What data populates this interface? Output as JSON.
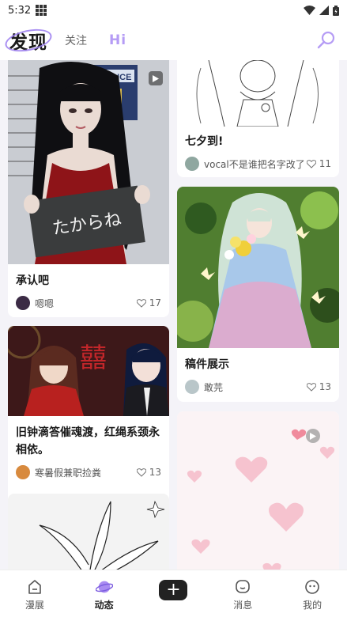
{
  "status_bar": {
    "time": "5:32"
  },
  "header": {
    "title": "发现",
    "tab_follow": "关注",
    "tab_hi": "Hi"
  },
  "posts": [
    {
      "title": "",
      "author": "",
      "likes": "",
      "thumb": "girl-in-red-dress-photo-police-lineup",
      "sign_text": "たからね",
      "sign2": "POLICE"
    },
    {
      "title": "七夕到!",
      "author": "vocal不是谁把名字改了",
      "likes": "11",
      "thumb": "lineart-anime-girl-sketch"
    },
    {
      "title": "承认吧",
      "author": "嗯嗯",
      "likes": "17"
    },
    {
      "title": "稿件展示",
      "author": "敢芫",
      "likes": "13",
      "thumb": "anime-girl-flowers-painting"
    },
    {
      "title": "旧钟滴答催魂渡，红绳系颈永相依。",
      "author": "寒暑假兼职捡粪",
      "likes": "13",
      "thumb": "two-anime-characters-red-wedding",
      "sign_text": "囍"
    },
    {
      "title": "",
      "author": "",
      "likes": "",
      "thumb": "pink-hearts-video"
    },
    {
      "title": "",
      "author": "",
      "likes": "",
      "thumb": "lily-flower-lineart"
    }
  ],
  "nav": {
    "items": [
      {
        "label": "漫展",
        "icon": "home-icon"
      },
      {
        "label": "动态",
        "icon": "planet-icon"
      },
      {
        "label": "",
        "icon": "plus-icon"
      },
      {
        "label": "消息",
        "icon": "message-icon"
      },
      {
        "label": "我的",
        "icon": "profile-icon"
      }
    ]
  },
  "colors": {
    "accent": "#b59cf5",
    "ring": "#9b7cf0",
    "background": "#f4f3f8"
  }
}
